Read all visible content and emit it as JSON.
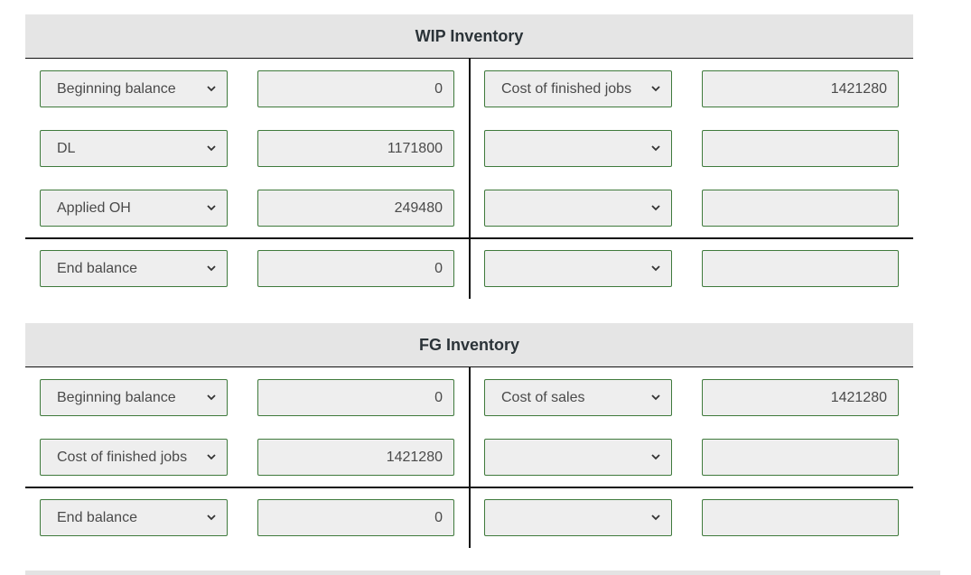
{
  "wip": {
    "title": "WIP Inventory",
    "rows": [
      {
        "debit_account": "Beginning balance",
        "debit_amount": "0",
        "credit_account": "Cost of finished jobs",
        "credit_amount": "1421280"
      },
      {
        "debit_account": "DL",
        "debit_amount": "1171800",
        "credit_account": "",
        "credit_amount": ""
      },
      {
        "debit_account": "Applied OH",
        "debit_amount": "249480",
        "credit_account": "",
        "credit_amount": ""
      },
      {
        "debit_account": "End balance",
        "debit_amount": "0",
        "credit_account": "",
        "credit_amount": ""
      }
    ]
  },
  "fg": {
    "title": "FG Inventory",
    "rows": [
      {
        "debit_account": "Beginning balance",
        "debit_amount": "0",
        "credit_account": "Cost of sales",
        "credit_amount": "1421280"
      },
      {
        "debit_account": "Cost of finished jobs",
        "debit_amount": "1421280",
        "credit_account": "",
        "credit_amount": ""
      },
      {
        "debit_account": "End balance",
        "debit_amount": "0",
        "credit_account": "",
        "credit_amount": ""
      }
    ]
  },
  "icons": {
    "dropdown": "chevron-down-icon"
  }
}
